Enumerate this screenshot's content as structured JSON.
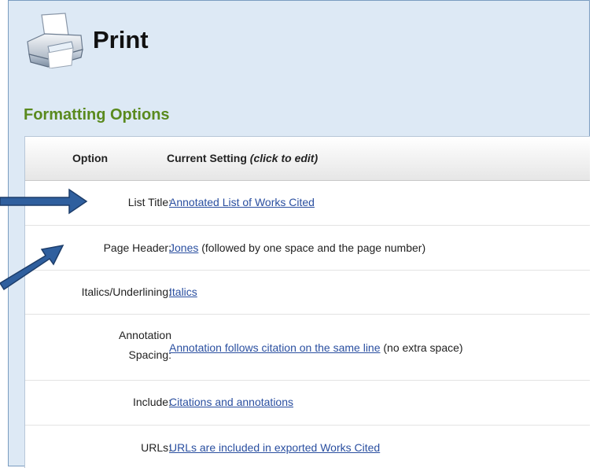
{
  "header": {
    "title": "Print",
    "icon": "printer-icon"
  },
  "section": {
    "title": "Formatting Options"
  },
  "table": {
    "col_option": "Option",
    "col_setting": "Current Setting",
    "col_setting_hint": "(click to edit)",
    "rows": [
      {
        "label": "List Title:",
        "link": "Annotated List of Works Cited",
        "note": ""
      },
      {
        "label": "Page Header:",
        "link": "Jones",
        "note": " (followed by one space and the page number)"
      },
      {
        "label": "Italics/Underlining:",
        "link": "Italics",
        "note": ""
      },
      {
        "label_line1": "Annotation",
        "label_line2": "Spacing:",
        "link": "Annotation follows citation on the same line",
        "note": " (no extra space)"
      },
      {
        "label": "Include:",
        "link": "Citations and annotations",
        "note": ""
      },
      {
        "label": "URLs:",
        "link": "URLs are included in exported Works Cited",
        "note": ""
      }
    ]
  },
  "colors": {
    "panel_bg": "#dde9f5",
    "section_green": "#5a8a1e",
    "link_blue": "#2a4fa0",
    "arrow_blue": "#2f5f9e"
  }
}
